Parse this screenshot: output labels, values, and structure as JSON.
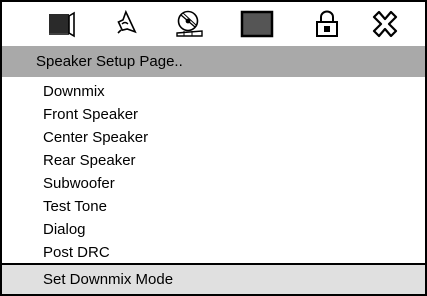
{
  "icon_bar": {
    "icons": [
      "language-setup-icon",
      "audio-speaker-icon",
      "disc-video-icon",
      "preference-icon",
      "password-lock-icon",
      "exit-icon"
    ]
  },
  "title": "Speaker Setup Page..",
  "menu": {
    "items": [
      "Downmix",
      "Front Speaker",
      "Center Speaker",
      "Rear Speaker",
      "Subwoofer",
      "Test Tone",
      "Dialog",
      "Post DRC"
    ]
  },
  "status": "Set Downmix Mode",
  "colors": {
    "title_bar": "#a9a9a9",
    "status_bar": "#e0e0e0",
    "frame": "#000000"
  }
}
